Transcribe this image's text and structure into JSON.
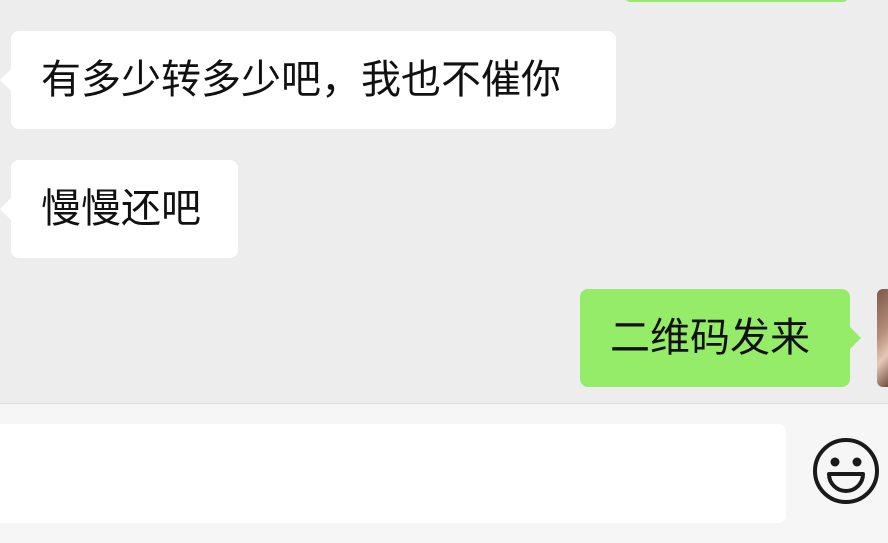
{
  "messages": [
    {
      "direction": "outgoing-partial",
      "text": ""
    },
    {
      "direction": "incoming",
      "text": "有多少转多少吧，我也不催你"
    },
    {
      "direction": "incoming",
      "text": "慢慢还吧"
    },
    {
      "direction": "outgoing",
      "text": "二维码发来"
    }
  ],
  "input": {
    "value": "",
    "placeholder": ""
  },
  "icons": {
    "emoji": "smiley-face-icon"
  },
  "colors": {
    "chat_background": "#ededed",
    "incoming_bubble": "#ffffff",
    "outgoing_bubble": "#95ec69",
    "input_bar": "#f6f6f6"
  }
}
